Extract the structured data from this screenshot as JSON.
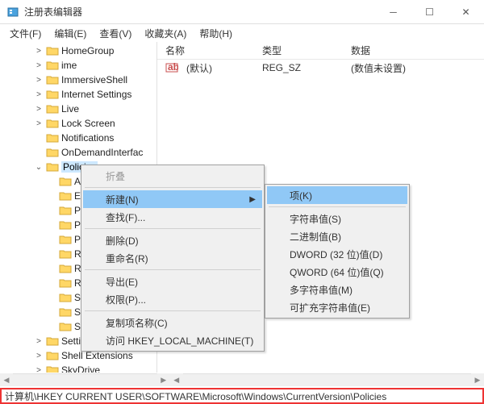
{
  "titlebar": {
    "title": "注册表编辑器"
  },
  "menu": {
    "file": "文件(F)",
    "edit": "编辑(E)",
    "view": "查看(V)",
    "fav": "收藏夹(A)",
    "help": "帮助(H)"
  },
  "tree": {
    "items": [
      {
        "label": "HomeGroup",
        "exp": ">",
        "indent": 2
      },
      {
        "label": "ime",
        "exp": ">",
        "indent": 2
      },
      {
        "label": "ImmersiveShell",
        "exp": ">",
        "indent": 2
      },
      {
        "label": "Internet Settings",
        "exp": ">",
        "indent": 2
      },
      {
        "label": "Live",
        "exp": ">",
        "indent": 2
      },
      {
        "label": "Lock Screen",
        "exp": ">",
        "indent": 2
      },
      {
        "label": "Notifications",
        "exp": "",
        "indent": 2
      },
      {
        "label": "OnDemandInterfac",
        "exp": "",
        "indent": 2
      },
      {
        "label": "Policies",
        "exp": "v",
        "indent": 2,
        "selected": true
      },
      {
        "label": "A",
        "exp": "",
        "indent": 3
      },
      {
        "label": "E",
        "exp": "",
        "indent": 3
      },
      {
        "label": "P",
        "exp": "",
        "indent": 3
      },
      {
        "label": "P",
        "exp": "",
        "indent": 3
      },
      {
        "label": "P",
        "exp": "",
        "indent": 3
      },
      {
        "label": "R",
        "exp": "",
        "indent": 3
      },
      {
        "label": "R",
        "exp": "",
        "indent": 3
      },
      {
        "label": "R",
        "exp": "",
        "indent": 3
      },
      {
        "label": "S",
        "exp": "",
        "indent": 3
      },
      {
        "label": "S",
        "exp": "",
        "indent": 3
      },
      {
        "label": "S",
        "exp": "",
        "indent": 3
      },
      {
        "label": "SettingSync",
        "exp": ">",
        "indent": 2
      },
      {
        "label": "Shell Extensions",
        "exp": ">",
        "indent": 2
      },
      {
        "label": "SkyDrive",
        "exp": ">",
        "indent": 2
      }
    ]
  },
  "list": {
    "cols": {
      "name": "名称",
      "type": "类型",
      "data": "数据"
    },
    "row": {
      "name": "(默认)",
      "type": "REG_SZ",
      "data": "(数值未设置)"
    }
  },
  "ctx1": {
    "collapse": "折叠",
    "new": "新建(N)",
    "find": "查找(F)...",
    "delete": "删除(D)",
    "rename": "重命名(R)",
    "export": "导出(E)",
    "perm": "权限(P)...",
    "copykey": "复制项名称(C)",
    "goto": "访问 HKEY_LOCAL_MACHINE(T)"
  },
  "ctx2": {
    "key": "项(K)",
    "string": "字符串值(S)",
    "binary": "二进制值(B)",
    "dword": "DWORD (32 位)值(D)",
    "qword": "QWORD (64 位)值(Q)",
    "multi": "多字符串值(M)",
    "expand": "可扩充字符串值(E)"
  },
  "statusbar": {
    "path": "计算机\\HKEY CURRENT USER\\SOFTWARE\\Microsoft\\Windows\\CurrentVersion\\Policies"
  }
}
